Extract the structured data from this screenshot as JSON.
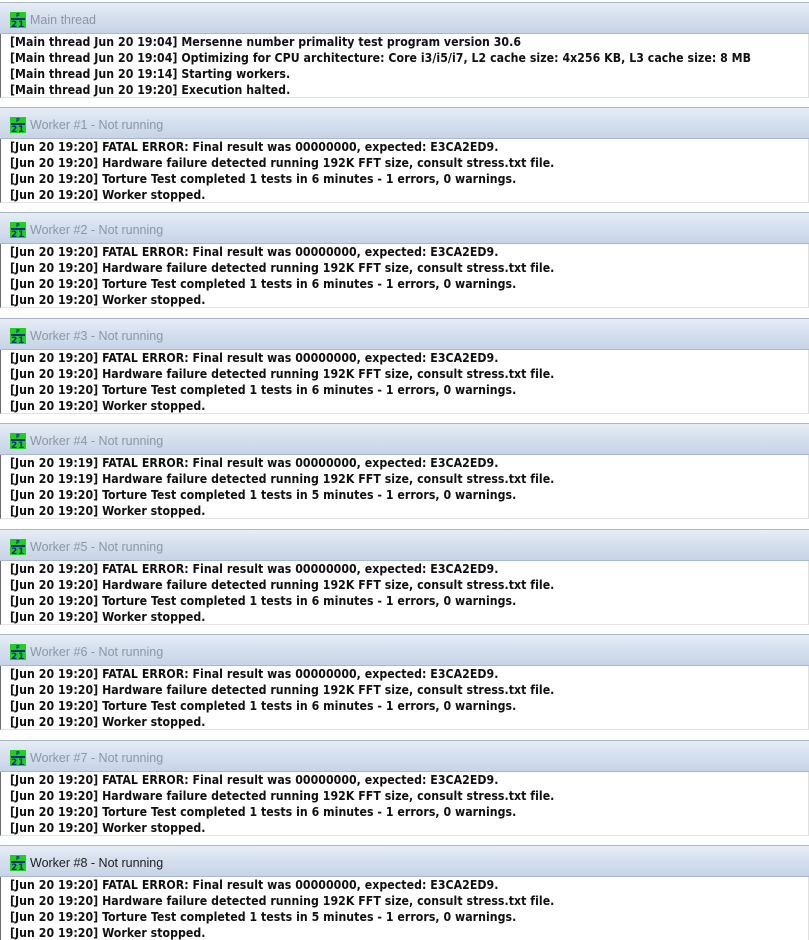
{
  "windows": [
    {
      "title": "Main thread",
      "active": false,
      "lines": [
        "[Main thread Jun 20 19:04] Mersenne number primality test program version 30.6",
        "[Main thread Jun 20 19:04] Optimizing for CPU architecture: Core i3/i5/i7, L2 cache size: 4x256 KB, L3 cache size: 8 MB",
        "[Main thread Jun 20 19:14] Starting workers.",
        "[Main thread Jun 20 19:20] Execution halted."
      ]
    },
    {
      "title": "Worker #1 - Not running",
      "active": false,
      "lines": [
        "[Jun 20 19:20] FATAL ERROR: Final result was 00000000, expected: E3CA2ED9.",
        "[Jun 20 19:20] Hardware failure detected running 192K FFT size, consult stress.txt file.",
        "[Jun 20 19:20] Torture Test completed 1 tests in 6 minutes - 1 errors, 0 warnings.",
        "[Jun 20 19:20] Worker stopped."
      ]
    },
    {
      "title": "Worker #2 - Not running",
      "active": false,
      "lines": [
        "[Jun 20 19:20] FATAL ERROR: Final result was 00000000, expected: E3CA2ED9.",
        "[Jun 20 19:20] Hardware failure detected running 192K FFT size, consult stress.txt file.",
        "[Jun 20 19:20] Torture Test completed 1 tests in 6 minutes - 1 errors, 0 warnings.",
        "[Jun 20 19:20] Worker stopped."
      ]
    },
    {
      "title": "Worker #3 - Not running",
      "active": false,
      "lines": [
        "[Jun 20 19:20] FATAL ERROR: Final result was 00000000, expected: E3CA2ED9.",
        "[Jun 20 19:20] Hardware failure detected running 192K FFT size, consult stress.txt file.",
        "[Jun 20 19:20] Torture Test completed 1 tests in 6 minutes - 1 errors, 0 warnings.",
        "[Jun 20 19:20] Worker stopped."
      ]
    },
    {
      "title": "Worker #4 - Not running",
      "active": false,
      "lines": [
        "[Jun 20 19:19] FATAL ERROR: Final result was 00000000, expected: E3CA2ED9.",
        "[Jun 20 19:19] Hardware failure detected running 192K FFT size, consult stress.txt file.",
        "[Jun 20 19:20] Torture Test completed 1 tests in 5 minutes - 1 errors, 0 warnings.",
        "[Jun 20 19:20] Worker stopped."
      ]
    },
    {
      "title": "Worker #5 - Not running",
      "active": false,
      "lines": [
        "[Jun 20 19:20] FATAL ERROR: Final result was 00000000, expected: E3CA2ED9.",
        "[Jun 20 19:20] Hardware failure detected running 192K FFT size, consult stress.txt file.",
        "[Jun 20 19:20] Torture Test completed 1 tests in 6 minutes - 1 errors, 0 warnings.",
        "[Jun 20 19:20] Worker stopped."
      ]
    },
    {
      "title": "Worker #6 - Not running",
      "active": false,
      "lines": [
        "[Jun 20 19:20] FATAL ERROR: Final result was 00000000, expected: E3CA2ED9.",
        "[Jun 20 19:20] Hardware failure detected running 192K FFT size, consult stress.txt file.",
        "[Jun 20 19:20] Torture Test completed 1 tests in 6 minutes - 1 errors, 0 warnings.",
        "[Jun 20 19:20] Worker stopped."
      ]
    },
    {
      "title": "Worker #7 - Not running",
      "active": false,
      "lines": [
        "[Jun 20 19:20] FATAL ERROR: Final result was 00000000, expected: E3CA2ED9.",
        "[Jun 20 19:20] Hardware failure detected running 192K FFT size, consult stress.txt file.",
        "[Jun 20 19:20] Torture Test completed 1 tests in 6 minutes - 1 errors, 0 warnings.",
        "[Jun 20 19:20] Worker stopped."
      ]
    },
    {
      "title": "Worker #8 - Not running",
      "active": true,
      "lines": [
        "[Jun 20 19:20] FATAL ERROR: Final result was 00000000, expected: E3CA2ED9.",
        "[Jun 20 19:20] Hardware failure detected running 192K FFT size, consult stress.txt file.",
        "[Jun 20 19:20] Torture Test completed 1 tests in 5 minutes - 1 errors, 0 warnings.",
        "[Jun 20 19:20] Worker stopped."
      ]
    }
  ]
}
